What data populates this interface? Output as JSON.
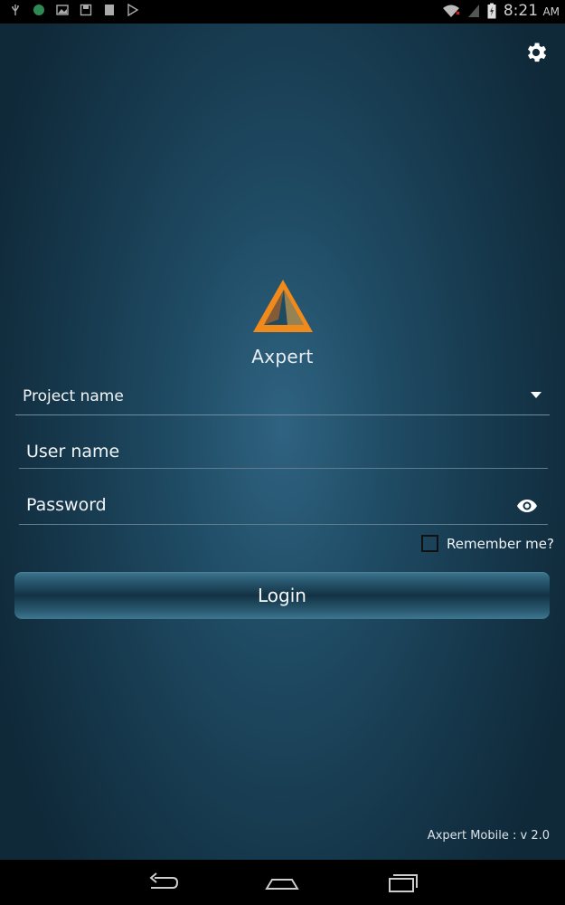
{
  "status_bar": {
    "left_icons": [
      "usb-icon",
      "notification-dot-icon",
      "image-icon",
      "save-icon",
      "storage-icon",
      "play-store-icon"
    ],
    "right_icons": [
      "wifi-icon",
      "signal-icon",
      "battery-charging-icon"
    ],
    "time": "8:21",
    "ampm": "AM"
  },
  "header": {
    "settings_icon": "gear-icon"
  },
  "brand": {
    "name": "Axpert",
    "logo_colors": {
      "outer": "#f08a1a",
      "inner": "#f7b24a"
    }
  },
  "form": {
    "project": {
      "label": "Project name"
    },
    "username": {
      "placeholder": "User name"
    },
    "password": {
      "placeholder": "Password"
    },
    "remember": {
      "label": "Remember me?",
      "checked": false
    },
    "login_label": "Login"
  },
  "footer": {
    "version": "Axpert Mobile : v 2.0"
  },
  "nav_bar": [
    "back-icon",
    "home-icon",
    "recents-icon"
  ]
}
